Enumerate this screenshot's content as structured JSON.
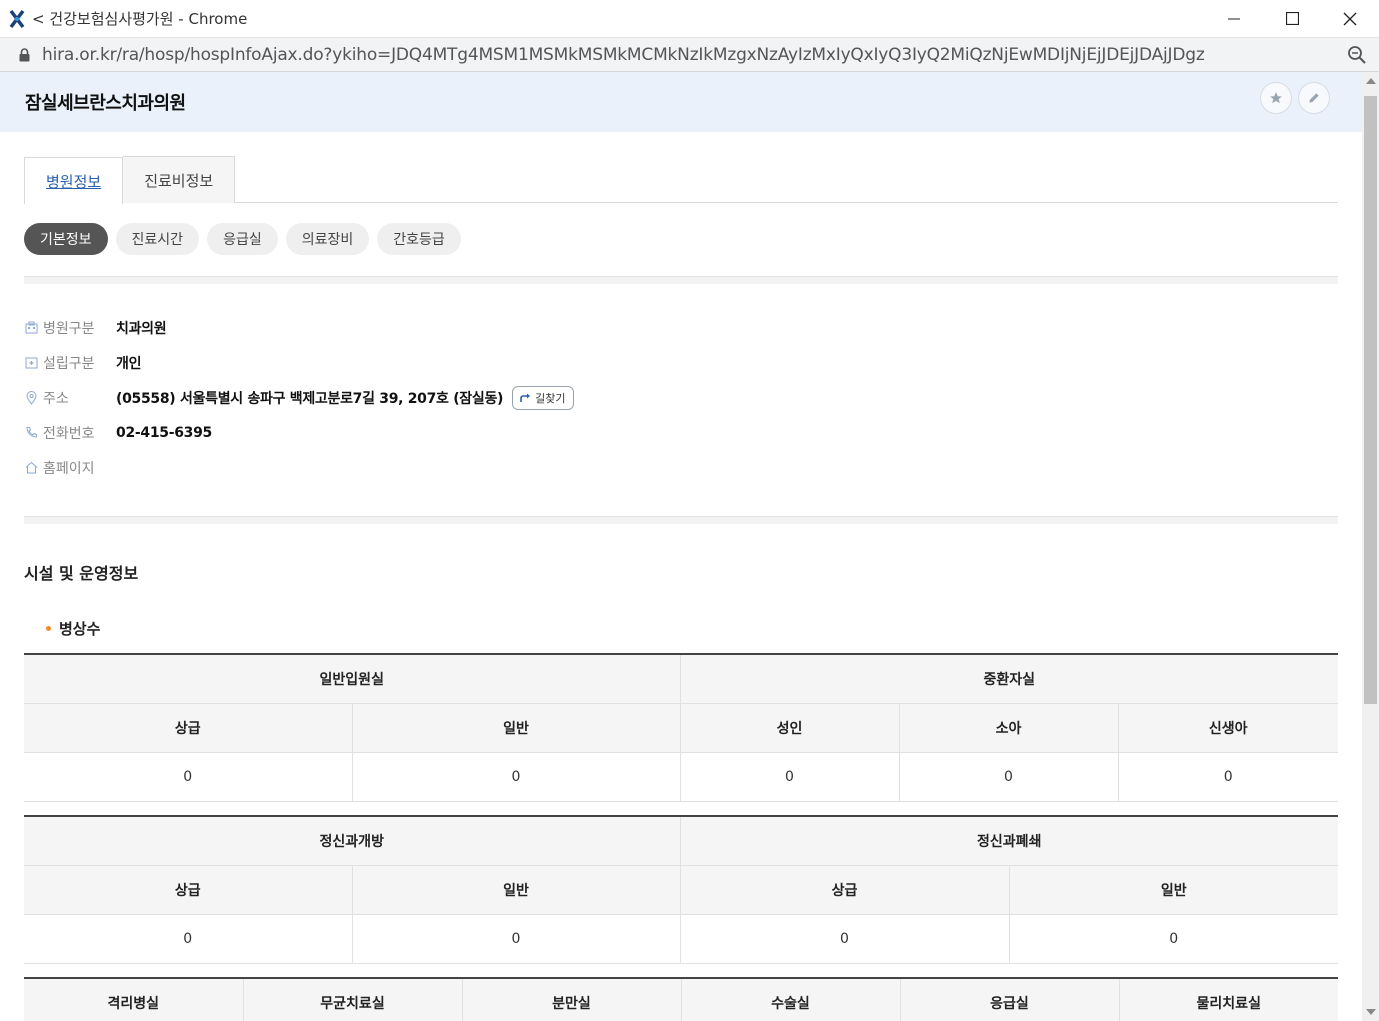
{
  "window": {
    "title": "< 건강보험심사평가원 - Chrome",
    "url": "hira.or.kr/ra/hosp/hospInfoAjax.do?ykiho=JDQ4MTg4MSM1MSMkMSMkMCMkNzIkMzgxNzAyIzMxIyQxIyQ3IyQ2MiQzNjEwMDIjNjEjJDEjJDAjJDgz"
  },
  "header": {
    "hospital_name": "잠실세브란스치과의원"
  },
  "tabs": [
    {
      "label": "병원정보",
      "active": true
    },
    {
      "label": "진료비정보",
      "active": false
    }
  ],
  "chips": [
    {
      "label": "기본정보",
      "active": true
    },
    {
      "label": "진료시간",
      "active": false
    },
    {
      "label": "응급실",
      "active": false
    },
    {
      "label": "의료장비",
      "active": false
    },
    {
      "label": "간호등급",
      "active": false
    }
  ],
  "info": {
    "type_label": "병원구분",
    "type_value": "치과의원",
    "founder_label": "설립구분",
    "founder_value": "개인",
    "address_label": "주소",
    "address_value": "(05558) 서울특별시 송파구 백제고분로7길 39, 207호 (잠실동)",
    "directions_button": "길찾기",
    "phone_label": "전화번호",
    "phone_value": "02-415-6395",
    "homepage_label": "홈페이지",
    "homepage_value": ""
  },
  "facility": {
    "section_title": "시설 및 운영정보",
    "beds_title": "병상수",
    "table1": {
      "group_general": "일반입원실",
      "group_icu": "중환자실",
      "headers": [
        "상급",
        "일반",
        "성인",
        "소아",
        "신생아"
      ],
      "values": [
        "0",
        "0",
        "0",
        "0",
        "0"
      ]
    },
    "table2": {
      "group_open": "정신과개방",
      "group_closed": "정신과폐쇄",
      "headers": [
        "상급",
        "일반",
        "상급",
        "일반"
      ],
      "values": [
        "0",
        "0",
        "0",
        "0"
      ]
    },
    "table3": {
      "headers": [
        "격리병실",
        "무균치료실",
        "분만실",
        "수술실",
        "응급실",
        "물리치료실"
      ]
    }
  },
  "colors": {
    "header_bg": "#eaf1fb",
    "active_tab_text": "#2a5fae",
    "active_chip_bg": "#555555",
    "bullet": "#f08c2c"
  }
}
